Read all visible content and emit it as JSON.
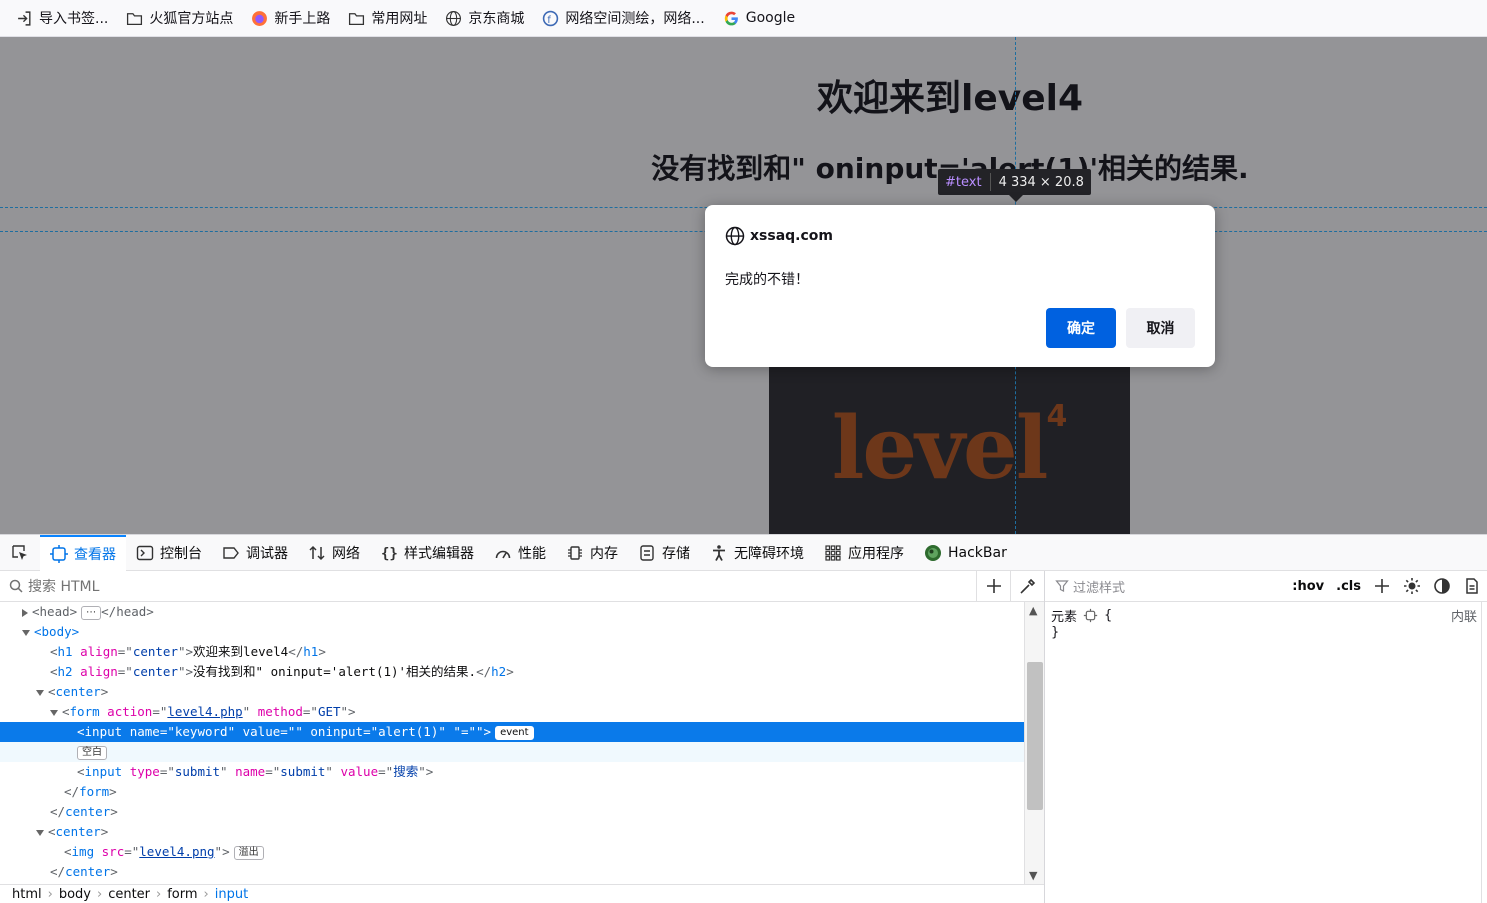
{
  "bookmarks": [
    {
      "label": "导入书签...",
      "icon": "import-icon"
    },
    {
      "label": "火狐官方站点",
      "icon": "folder-icon"
    },
    {
      "label": "新手上路",
      "icon": "firefox-icon"
    },
    {
      "label": "常用网址",
      "icon": "folder-icon"
    },
    {
      "label": "京东商城",
      "icon": "globe-icon"
    },
    {
      "label": "网络空间测绘，网络...",
      "icon": "fofa-icon"
    },
    {
      "label": "Google",
      "icon": "google-icon"
    }
  ],
  "page": {
    "h1": "欢迎来到level4",
    "h2": "没有找到和\" oninput='alert(1)'相关的结果.",
    "image_text": "level",
    "image_sup": "4"
  },
  "infobar": {
    "tag": "#text",
    "dims": "4   334 × 20.8"
  },
  "dialog": {
    "origin": "xssaq.com",
    "message": "完成的不错！",
    "ok_label": "确定",
    "cancel_label": "取消"
  },
  "devtools": {
    "tabs": [
      {
        "label": "查看器",
        "icon": "inspector-icon",
        "active": true
      },
      {
        "label": "控制台",
        "icon": "console-icon"
      },
      {
        "label": "调试器",
        "icon": "debugger-icon"
      },
      {
        "label": "网络",
        "icon": "network-icon"
      },
      {
        "label": "样式编辑器",
        "icon": "style-editor-icon"
      },
      {
        "label": "性能",
        "icon": "performance-icon"
      },
      {
        "label": "内存",
        "icon": "memory-icon"
      },
      {
        "label": "存储",
        "icon": "storage-icon"
      },
      {
        "label": "无障碍环境",
        "icon": "accessibility-icon"
      },
      {
        "label": "应用程序",
        "icon": "application-icon"
      },
      {
        "label": "HackBar",
        "icon": "hackbar-icon"
      }
    ],
    "search_placeholder": "搜索 HTML",
    "markup": {
      "head_open": "<head>",
      "head_close": "</head>",
      "ellipsis": "⋯",
      "body_open": "<body>",
      "h1_text": "欢迎来到level4",
      "h2_text": "没有找到和\" oninput='alert(1)'相关的结果.",
      "form_action": "level4.php",
      "form_method": "GET",
      "input1_name": "keyword",
      "input1_value": "",
      "input1_oninput": "alert(1)",
      "input1_extra": "\"=\"\"",
      "event_badge": "event",
      "whitespace_badge": "空白",
      "input2_type": "submit",
      "input2_name": "submit",
      "input2_value": "搜索",
      "img_src": "level4.png",
      "overflow_badge": "溢出"
    },
    "breadcrumb": [
      "html",
      "body",
      "center",
      "form",
      "input"
    ],
    "rules": {
      "filter_placeholder": "过滤样式",
      "hov": ":hov",
      "cls": ".cls",
      "element_label": "元素",
      "open_brace": "{",
      "close_brace": "}",
      "inline_label": "内联"
    }
  }
}
